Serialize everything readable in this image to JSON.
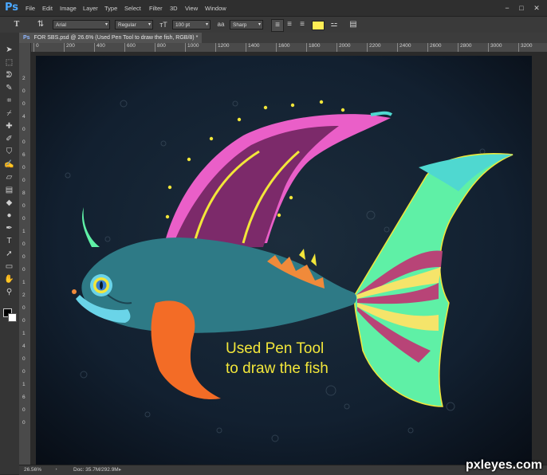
{
  "app": {
    "logo": "Ps"
  },
  "menubar": {
    "items": [
      "File",
      "Edit",
      "Image",
      "Layer",
      "Type",
      "Select",
      "Filter",
      "3D",
      "View",
      "Window"
    ]
  },
  "window_controls": {
    "minimize": "−",
    "restore": "□",
    "close": "✕"
  },
  "options_bar": {
    "tool_glyph": "T",
    "font_family": "Arial",
    "font_style": "Regular",
    "font_size": "100 pt",
    "antialias": "Sharp",
    "aa_glyph": "aa",
    "text_color": "#ffee55"
  },
  "document_tab": {
    "title": "FOR SBS.psd @ 26.6% (Used Pen Tool to draw the fish, RGB/8)",
    "modified_marker": "*",
    "close": "×"
  },
  "ruler": {
    "top_labels": [
      "0",
      "200",
      "400",
      "600",
      "800",
      "1000",
      "1200",
      "1400",
      "1600",
      "1800",
      "2000",
      "2200",
      "2400",
      "2600",
      "2800",
      "3000",
      "3200",
      "3400"
    ],
    "left_labels": [
      "2",
      "0",
      "0",
      "4",
      "0",
      "0",
      "6",
      "0",
      "0",
      "8",
      "0",
      "0",
      "1",
      "0",
      "0",
      "0",
      "1",
      "2",
      "0",
      "0",
      "1",
      "4",
      "0",
      "0",
      "1",
      "6",
      "0",
      "0"
    ]
  },
  "canvas": {
    "caption_line1": "Used Pen Tool",
    "caption_line2": "to draw the fish",
    "caption_color": "#f2e63a",
    "background_color": "#0f1a26"
  },
  "status": {
    "zoom": "26.56%",
    "doc": "Doc: 35.7M/292.9M"
  },
  "watermark": "pxleyes.com",
  "tools": [
    {
      "name": "move-tool-icon",
      "glyph": "➤"
    },
    {
      "name": "marquee-tool-icon",
      "glyph": "⬚"
    },
    {
      "name": "lasso-tool-icon",
      "glyph": "ᕲ"
    },
    {
      "name": "quick-select-tool-icon",
      "glyph": "✎"
    },
    {
      "name": "crop-tool-icon",
      "glyph": "⌗"
    },
    {
      "name": "eyedropper-tool-icon",
      "glyph": "⌿"
    },
    {
      "name": "healing-brush-tool-icon",
      "glyph": "✚"
    },
    {
      "name": "brush-tool-icon",
      "glyph": "✐"
    },
    {
      "name": "clone-stamp-tool-icon",
      "glyph": "⛉"
    },
    {
      "name": "history-brush-tool-icon",
      "glyph": "✍"
    },
    {
      "name": "eraser-tool-icon",
      "glyph": "▱"
    },
    {
      "name": "gradient-tool-icon",
      "glyph": "▤"
    },
    {
      "name": "blur-tool-icon",
      "glyph": "◆"
    },
    {
      "name": "dodge-tool-icon",
      "glyph": "●"
    },
    {
      "name": "pen-tool-icon",
      "glyph": "✒"
    },
    {
      "name": "type-tool-icon",
      "glyph": "T"
    },
    {
      "name": "path-select-tool-icon",
      "glyph": "➚"
    },
    {
      "name": "shape-tool-icon",
      "glyph": "▭"
    },
    {
      "name": "hand-tool-icon",
      "glyph": "✋"
    },
    {
      "name": "zoom-tool-icon",
      "glyph": "⚲"
    }
  ]
}
